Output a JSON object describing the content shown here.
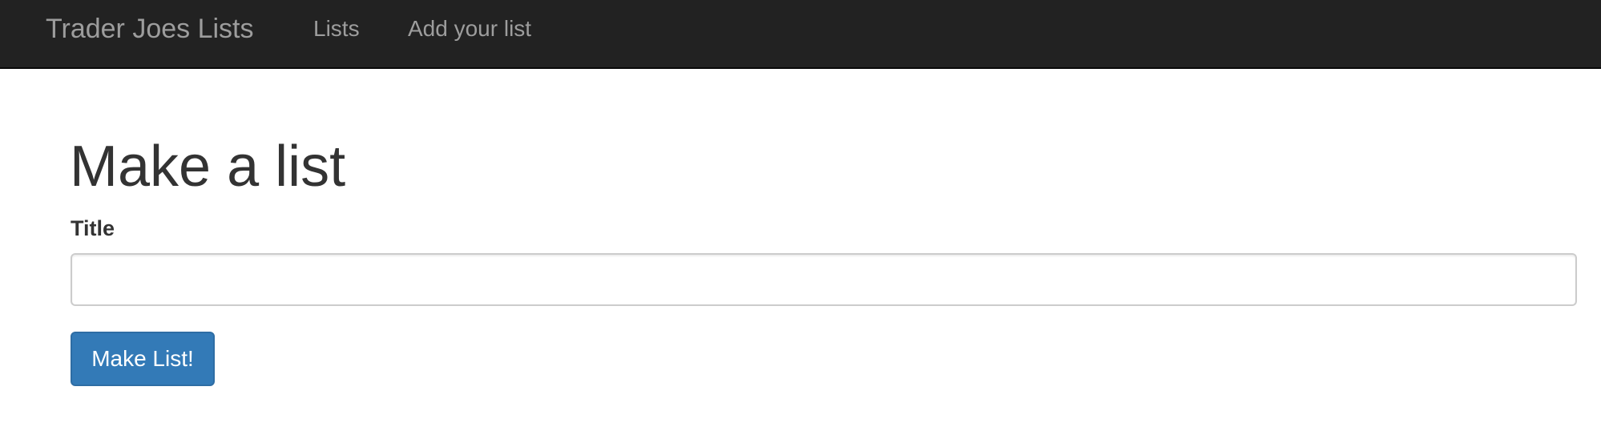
{
  "navbar": {
    "brand": "Trader Joes Lists",
    "links": [
      {
        "label": "Lists"
      },
      {
        "label": "Add your list"
      }
    ]
  },
  "main": {
    "heading": "Make a list",
    "form": {
      "title_label": "Title",
      "title_value": "",
      "title_placeholder": "",
      "submit_label": "Make List!"
    }
  },
  "colors": {
    "navbar_bg": "#222222",
    "nav_text": "#9d9d9d",
    "heading_text": "#333333",
    "button_bg": "#337ab7",
    "button_text": "#ffffff"
  }
}
